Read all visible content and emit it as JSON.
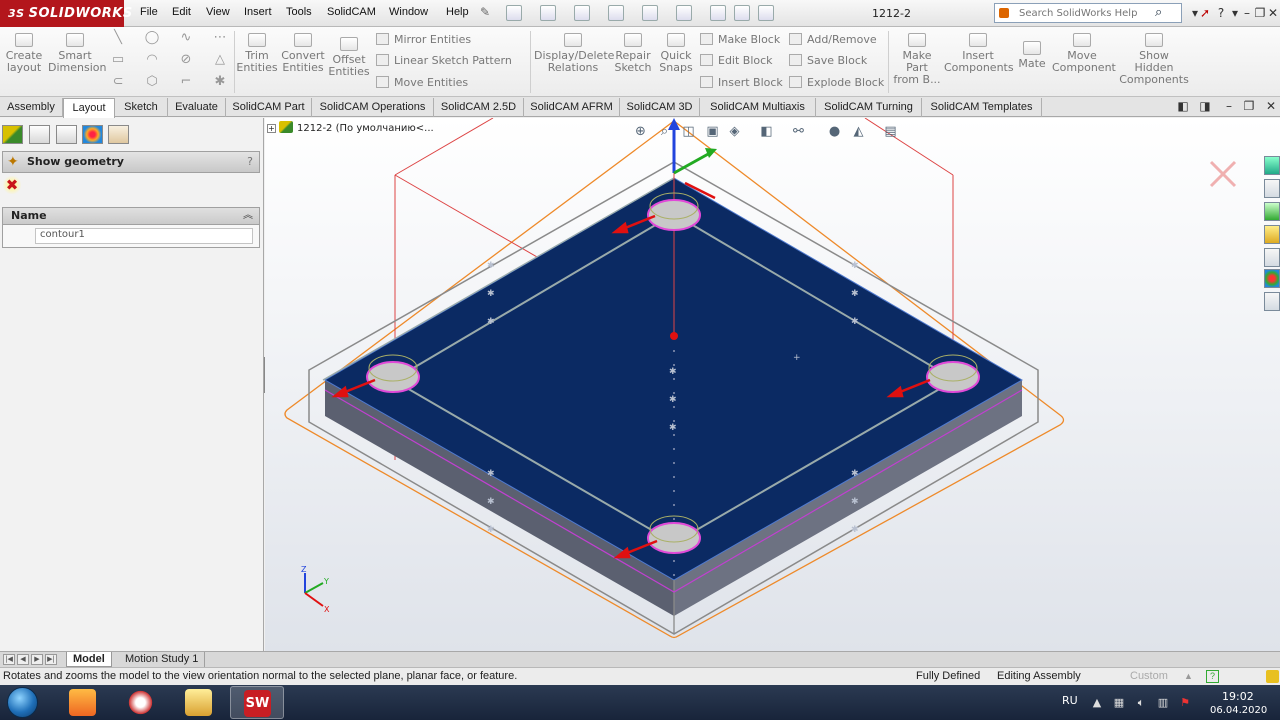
{
  "app": {
    "logo_text": "SOLIDWORKS",
    "document_title": "1212-2",
    "menu": [
      "File",
      "Edit",
      "View",
      "Insert",
      "Tools",
      "SolidCAM",
      "Window",
      "Help"
    ],
    "search_placeholder": "Search SolidWorks Help"
  },
  "ribbon": {
    "create_layout": "Create layout",
    "smart_dimension": "Smart Dimension",
    "trim_entities": "Trim Entities",
    "convert_entities": "Convert Entities",
    "offset_entities": "Offset Entities",
    "mirror_entities": "Mirror Entities",
    "linear_sketch_pattern": "Linear Sketch Pattern",
    "move_entities": "Move Entities",
    "display_delete_relations": "Display/Delete Relations",
    "repair_sketch": "Repair Sketch",
    "quick_snaps": "Quick Snaps",
    "make_block": "Make Block",
    "edit_block": "Edit Block",
    "insert_block": "Insert Block",
    "add_remove": "Add/Remove",
    "save_block": "Save Block",
    "explode_block": "Explode Block",
    "make_part_from_block": "Make Part from B...",
    "insert_components": "Insert Components",
    "mate": "Mate",
    "move_component": "Move Component",
    "show_hidden_components": "Show Hidden Components"
  },
  "tabs": [
    "Assembly",
    "Layout",
    "Sketch",
    "Evaluate",
    "SolidCAM Part",
    "SolidCAM Operations",
    "SolidCAM 2.5D",
    "SolidCAM AFRM",
    "SolidCAM 3D",
    "SolidCAM Multiaxis",
    "SolidCAM Turning",
    "SolidCAM Templates"
  ],
  "active_tab": "Layout",
  "property_manager": {
    "title": "Show geometry",
    "help": "?",
    "name_header": "Name",
    "contour_value": "contour1"
  },
  "viewport": {
    "tree_node": "1212-2  (По умолчанию<..."
  },
  "bottom_tabs": {
    "model": "Model",
    "motion_study": "Motion Study 1"
  },
  "status": {
    "hint": "Rotates and zooms the model to the view orientation normal to the selected plane, planar face, or feature.",
    "fully_defined": "Fully Defined",
    "editing": "Editing Assembly",
    "units": "Custom"
  },
  "taskbar": {
    "lang": "RU",
    "time": "19:02",
    "date": "06.04.2020"
  },
  "colors": {
    "top_face": "#0b2a63",
    "side_face": "#5a5f6e",
    "accent_red": "#d01010",
    "orange_outline": "#ee8a2a",
    "pocket_outline": "#e04ad8"
  }
}
